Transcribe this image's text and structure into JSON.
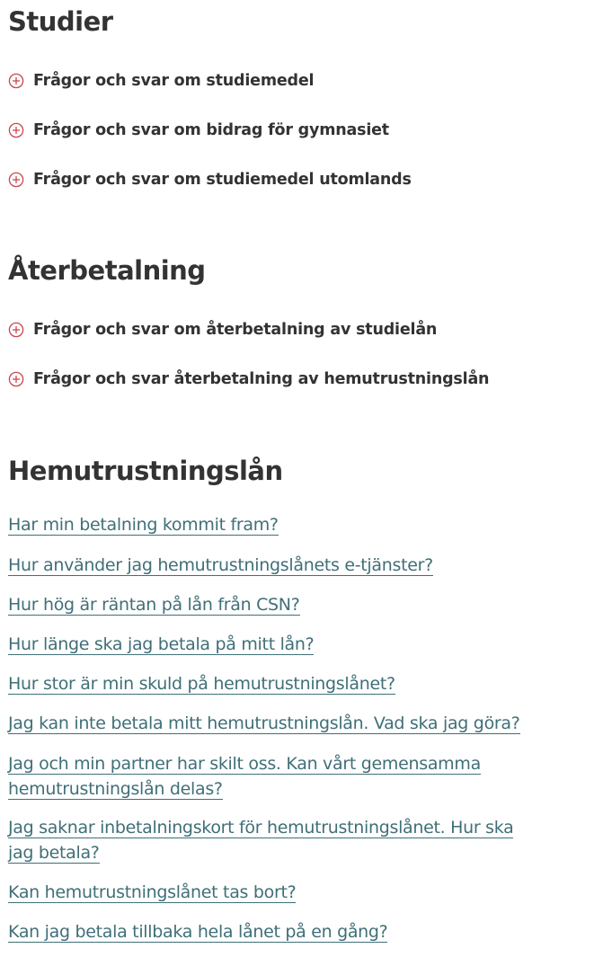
{
  "studier": {
    "title": "Studier",
    "items": [
      {
        "label": "Frågor och svar om studiemedel"
      },
      {
        "label": "Frågor och svar om bidrag för gymnasiet"
      },
      {
        "label": "Frågor och svar om studiemedel utomlands"
      }
    ]
  },
  "aterbetalning": {
    "title": "Återbetalning",
    "items": [
      {
        "label": "Frågor och svar om återbetalning av studielån"
      },
      {
        "label": "Frågor och svar återbetalning av hemutrustningslån"
      }
    ]
  },
  "hemutrustningslan": {
    "title": "Hemutrustningslån",
    "links": [
      "Har min betalning kommit fram?",
      "Hur använder jag hemutrustningslånets e-tjänster?",
      "Hur hög är räntan på lån från CSN?",
      "Hur länge ska jag betala på mitt lån?",
      "Hur stor är min skuld på hemutrustningslånet?",
      "Jag kan inte betala mitt hemutrustningslån. Vad ska jag göra?",
      "Jag och min partner har skilt oss. Kan vårt gemensamma hemutrustningslån delas?",
      "Jag saknar inbetalningskort för hemutrustningslånet. Hur ska jag betala?",
      "Kan hemutrustningslånet tas bort?",
      "Kan jag betala tillbaka hela lånet på en gång?"
    ]
  },
  "colors": {
    "heading": "#333333",
    "link": "#3f6f78",
    "accent_icon": "#c9474f"
  },
  "icons": {
    "expand": "plus-circle-icon"
  }
}
